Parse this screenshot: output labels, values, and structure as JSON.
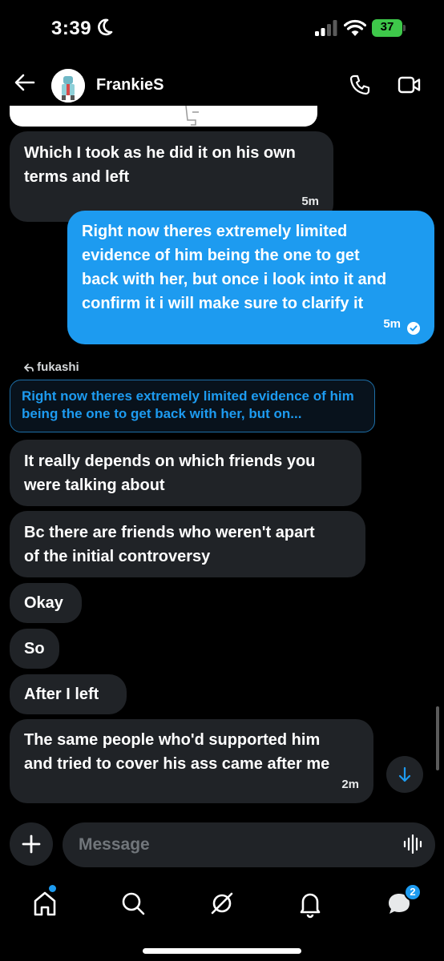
{
  "status_bar": {
    "time": "3:39",
    "battery": "37"
  },
  "header": {
    "name": "FrankieS"
  },
  "messages": [
    {
      "text": "Which I took as he did it on his own\nterms and left",
      "time": "5m"
    },
    {
      "text": "Right now theres extremely limited\nevidence of him being the one to get\nback with her, but once i look into it and\nconfirm it i will make sure to clarify it",
      "time": "5m"
    },
    {
      "text": "It really depends on which friends you\nwere talking about"
    },
    {
      "text": "Bc there are friends who weren't apart\nof the initial controversy"
    },
    {
      "text": "Okay"
    },
    {
      "text": "So"
    },
    {
      "text": "After I left"
    },
    {
      "text": "The same people who'd supported him\nand tried to cover his ass came after me",
      "time": "2m"
    }
  ],
  "reply": {
    "author": "fukashi",
    "quote": "Right now theres extremely limited evidence of him being the one to get back with her, but on..."
  },
  "composer": {
    "placeholder": "Message"
  },
  "tabbar": {
    "messages_badge": "2"
  },
  "colors": {
    "accent": "#1d9bf0",
    "bubble_received": "#202327",
    "background": "#000000"
  }
}
